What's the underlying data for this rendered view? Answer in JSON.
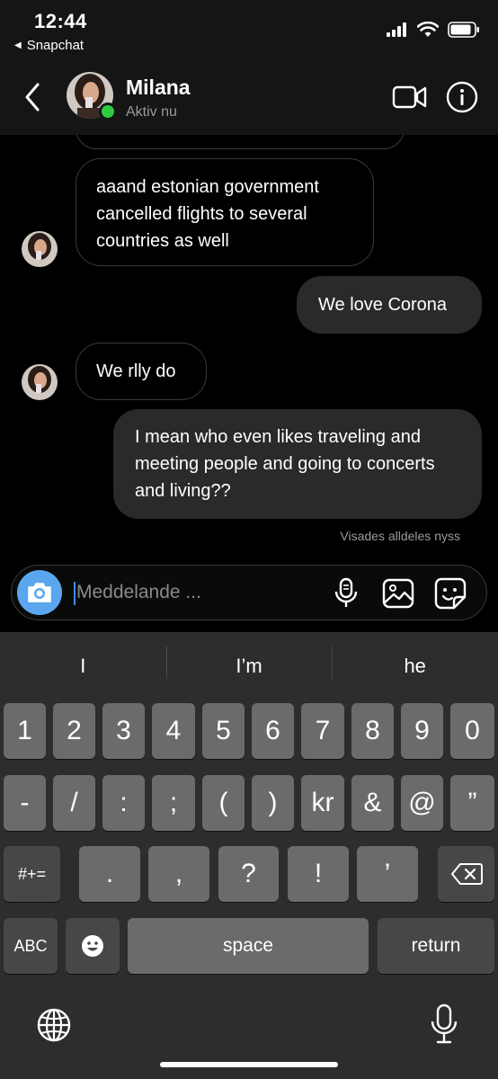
{
  "status_bar": {
    "time": "12:44",
    "back_app": "Snapchat"
  },
  "header": {
    "name": "Milana",
    "status": "Aktiv nu"
  },
  "colors": {
    "online": "#2ecc40",
    "camera": "#5aa7ee",
    "cursor": "#3d8df5"
  },
  "messages": [
    {
      "from": "them",
      "text": "aaand estonian government cancelled flights to several countries as well"
    },
    {
      "from": "me",
      "text": "We love Corona"
    },
    {
      "from": "them",
      "text": "We rlly do"
    },
    {
      "from": "me",
      "text": "I mean who even likes traveling and meeting people and going to concerts and living??"
    }
  ],
  "seen_label": "Visades alldeles nyss",
  "composer": {
    "placeholder": "Meddelande ..."
  },
  "keyboard": {
    "suggestions": [
      "I",
      "I’m",
      "he"
    ],
    "row1": [
      "1",
      "2",
      "3",
      "4",
      "5",
      "6",
      "7",
      "8",
      "9",
      "0"
    ],
    "row2": [
      "-",
      "/",
      ":",
      ";",
      "(",
      ")",
      "kr",
      "&",
      "@",
      "”"
    ],
    "row3": {
      "mode": "#+=",
      "keys": [
        ".",
        ",",
        "?",
        "!",
        "’"
      ]
    },
    "row4": {
      "abc": "ABC",
      "space": "space",
      "return": "return"
    }
  }
}
